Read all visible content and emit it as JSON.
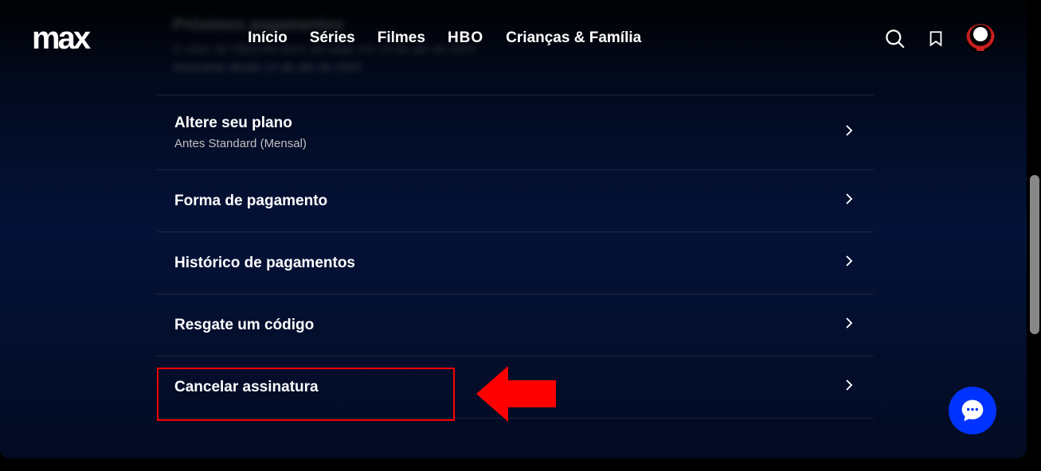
{
  "logo": "max",
  "nav": {
    "inicio": "Início",
    "series": "Séries",
    "filmes": "Filmes",
    "hbo": "HBO",
    "criancas": "Crianças & Família"
  },
  "blurred": {
    "title": "Próximos pagamentos",
    "line1": "O valor de R$34,90 deve ser pago em 19 de abr de 2024",
    "line2": "Assinante desde 14 de abr de 2024"
  },
  "menu": {
    "change_plan": {
      "title": "Altere seu plano",
      "subtitle": "Antes Standard (Mensal)"
    },
    "payment_method": "Forma de pagamento",
    "payment_history": "Histórico de pagamentos",
    "redeem_code": "Resgate um código",
    "cancel_subscription": "Cancelar assinatura"
  }
}
